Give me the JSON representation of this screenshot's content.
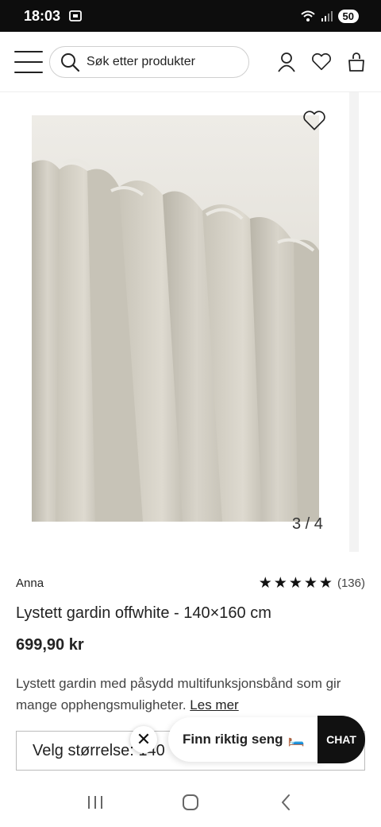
{
  "status": {
    "time": "18:03",
    "battery": "50"
  },
  "header": {
    "search_placeholder": "Søk etter produkter"
  },
  "gallery": {
    "counter": "3 / 4"
  },
  "product": {
    "brand": "Anna",
    "rating_stars": 5,
    "review_count": "(136)",
    "title": "Lystett gardin offwhite - 140×160 cm",
    "price": "699,90 kr",
    "description": "Lystett gardin med påsydd multifunksjonsbånd som gir mange opphengsmuligheter.",
    "read_more": "Les mer",
    "size_label": "Velg størrelse: 140"
  },
  "promo": {
    "text": "Finn riktig seng",
    "emoji": "🛏️",
    "chat_label": "CHAT"
  },
  "colors": {
    "accent": "#111111",
    "photo_bg": "#d9d6cd"
  }
}
